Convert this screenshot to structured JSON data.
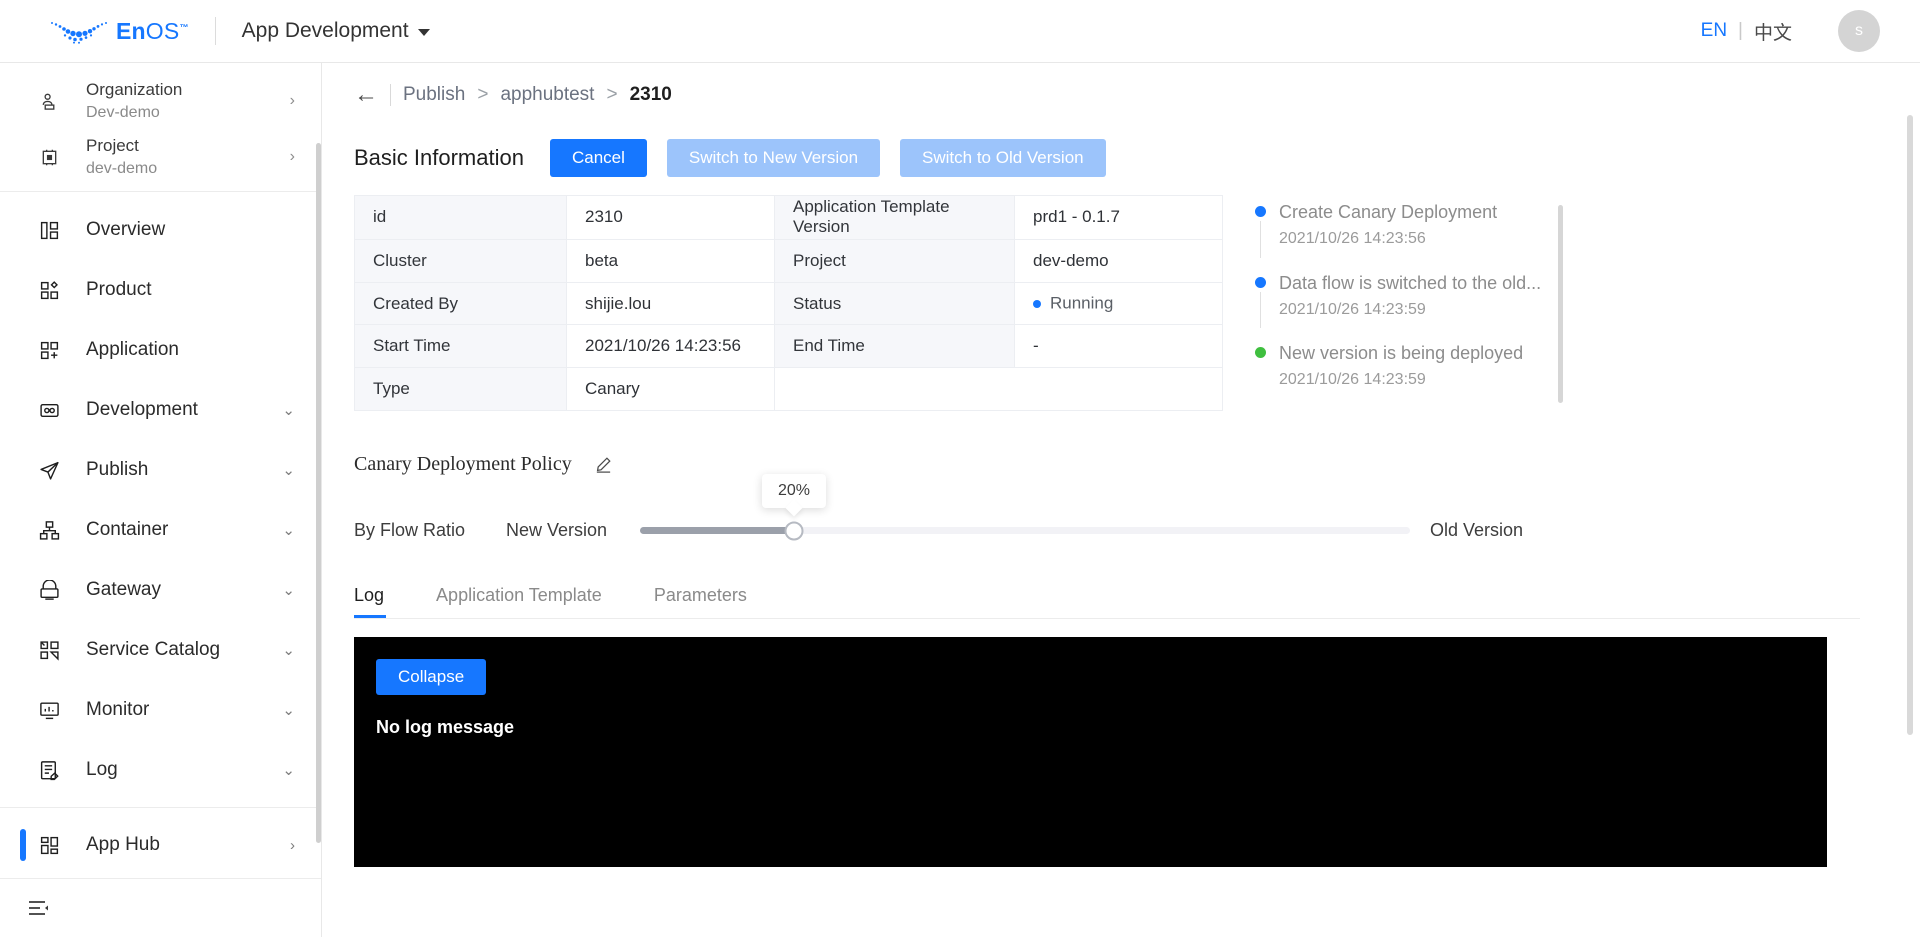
{
  "header": {
    "logo_text_en": "En",
    "logo_text_os": "OS",
    "logo_tm": "™",
    "app_switcher": "App Development",
    "lang_en": "EN",
    "lang_sep": "|",
    "lang_zh": "中文",
    "avatar_initial": "s"
  },
  "sidebar": {
    "context": [
      {
        "label": "Organization",
        "value": "Dev-demo",
        "icon": "organization-icon"
      },
      {
        "label": "Project",
        "value": "dev-demo",
        "icon": "project-icon"
      }
    ],
    "items": [
      {
        "label": "Overview",
        "icon": "overview-icon",
        "chevron": "",
        "active": false
      },
      {
        "label": "Product",
        "icon": "product-icon",
        "chevron": "",
        "active": false
      },
      {
        "label": "Application",
        "icon": "application-icon",
        "chevron": "",
        "active": false
      },
      {
        "label": "Development",
        "icon": "development-icon",
        "chevron": "⌄",
        "active": false
      },
      {
        "label": "Publish",
        "icon": "publish-icon",
        "chevron": "⌄",
        "active": false
      },
      {
        "label": "Container",
        "icon": "container-icon",
        "chevron": "⌄",
        "active": false
      },
      {
        "label": "Gateway",
        "icon": "gateway-icon",
        "chevron": "⌄",
        "active": false
      },
      {
        "label": "Service Catalog",
        "icon": "service-catalog-icon",
        "chevron": "⌄",
        "active": false
      },
      {
        "label": "Monitor",
        "icon": "monitor-icon",
        "chevron": "⌄",
        "active": false
      },
      {
        "label": "Log",
        "icon": "log-icon",
        "chevron": "⌄",
        "active": false
      },
      {
        "label": "App Hub",
        "icon": "app-hub-icon",
        "chevron": "›",
        "active": true
      }
    ]
  },
  "breadcrumb": {
    "back": "←",
    "items": [
      "Publish",
      "apphubtest"
    ],
    "separator": ">",
    "current": "2310"
  },
  "section": {
    "title": "Basic Information",
    "cancel_label": "Cancel",
    "switch_new_label": "Switch to New Version",
    "switch_old_label": "Switch to Old Version"
  },
  "info_table": {
    "rows": [
      {
        "label1": "id",
        "value1": "2310",
        "label2": "Application Template Version",
        "value2": "prd1 - 0.1.7"
      },
      {
        "label1": "Cluster",
        "value1": "beta",
        "label2": "Project",
        "value2": "dev-demo"
      },
      {
        "label1": "Created By",
        "value1": "shijie.lou",
        "label2": "Status",
        "value2": "Running",
        "value2_dot": "#1677ff"
      },
      {
        "label1": "Start Time",
        "value1": "2021/10/26 14:23:56",
        "label2": "End Time",
        "value2": "-"
      },
      {
        "label1": "Type",
        "value1": "Canary",
        "label2": "",
        "value2": ""
      }
    ]
  },
  "timeline": [
    {
      "title": "Create Canary Deployment",
      "time": "2021/10/26 14:23:56",
      "color": "#1677ff"
    },
    {
      "title": "Data flow is switched to the old...",
      "time": "2021/10/26 14:23:59",
      "color": "#1677ff"
    },
    {
      "title": "New version is being deployed",
      "time": "2021/10/26 14:23:59",
      "color": "#3fbf3f"
    }
  ],
  "policy": {
    "title": "Canary Deployment Policy",
    "edit_icon": "edit-pencil-icon",
    "flow_label": "By Flow Ratio",
    "new_version_label": "New Version",
    "old_version_label": "Old Version",
    "slider_value": "20%",
    "slider_percent": 20
  },
  "tabs": [
    {
      "label": "Log",
      "active": true
    },
    {
      "label": "Application Template",
      "active": false
    },
    {
      "label": "Parameters",
      "active": false
    }
  ],
  "console": {
    "collapse_label": "Collapse",
    "message": "No log message"
  }
}
